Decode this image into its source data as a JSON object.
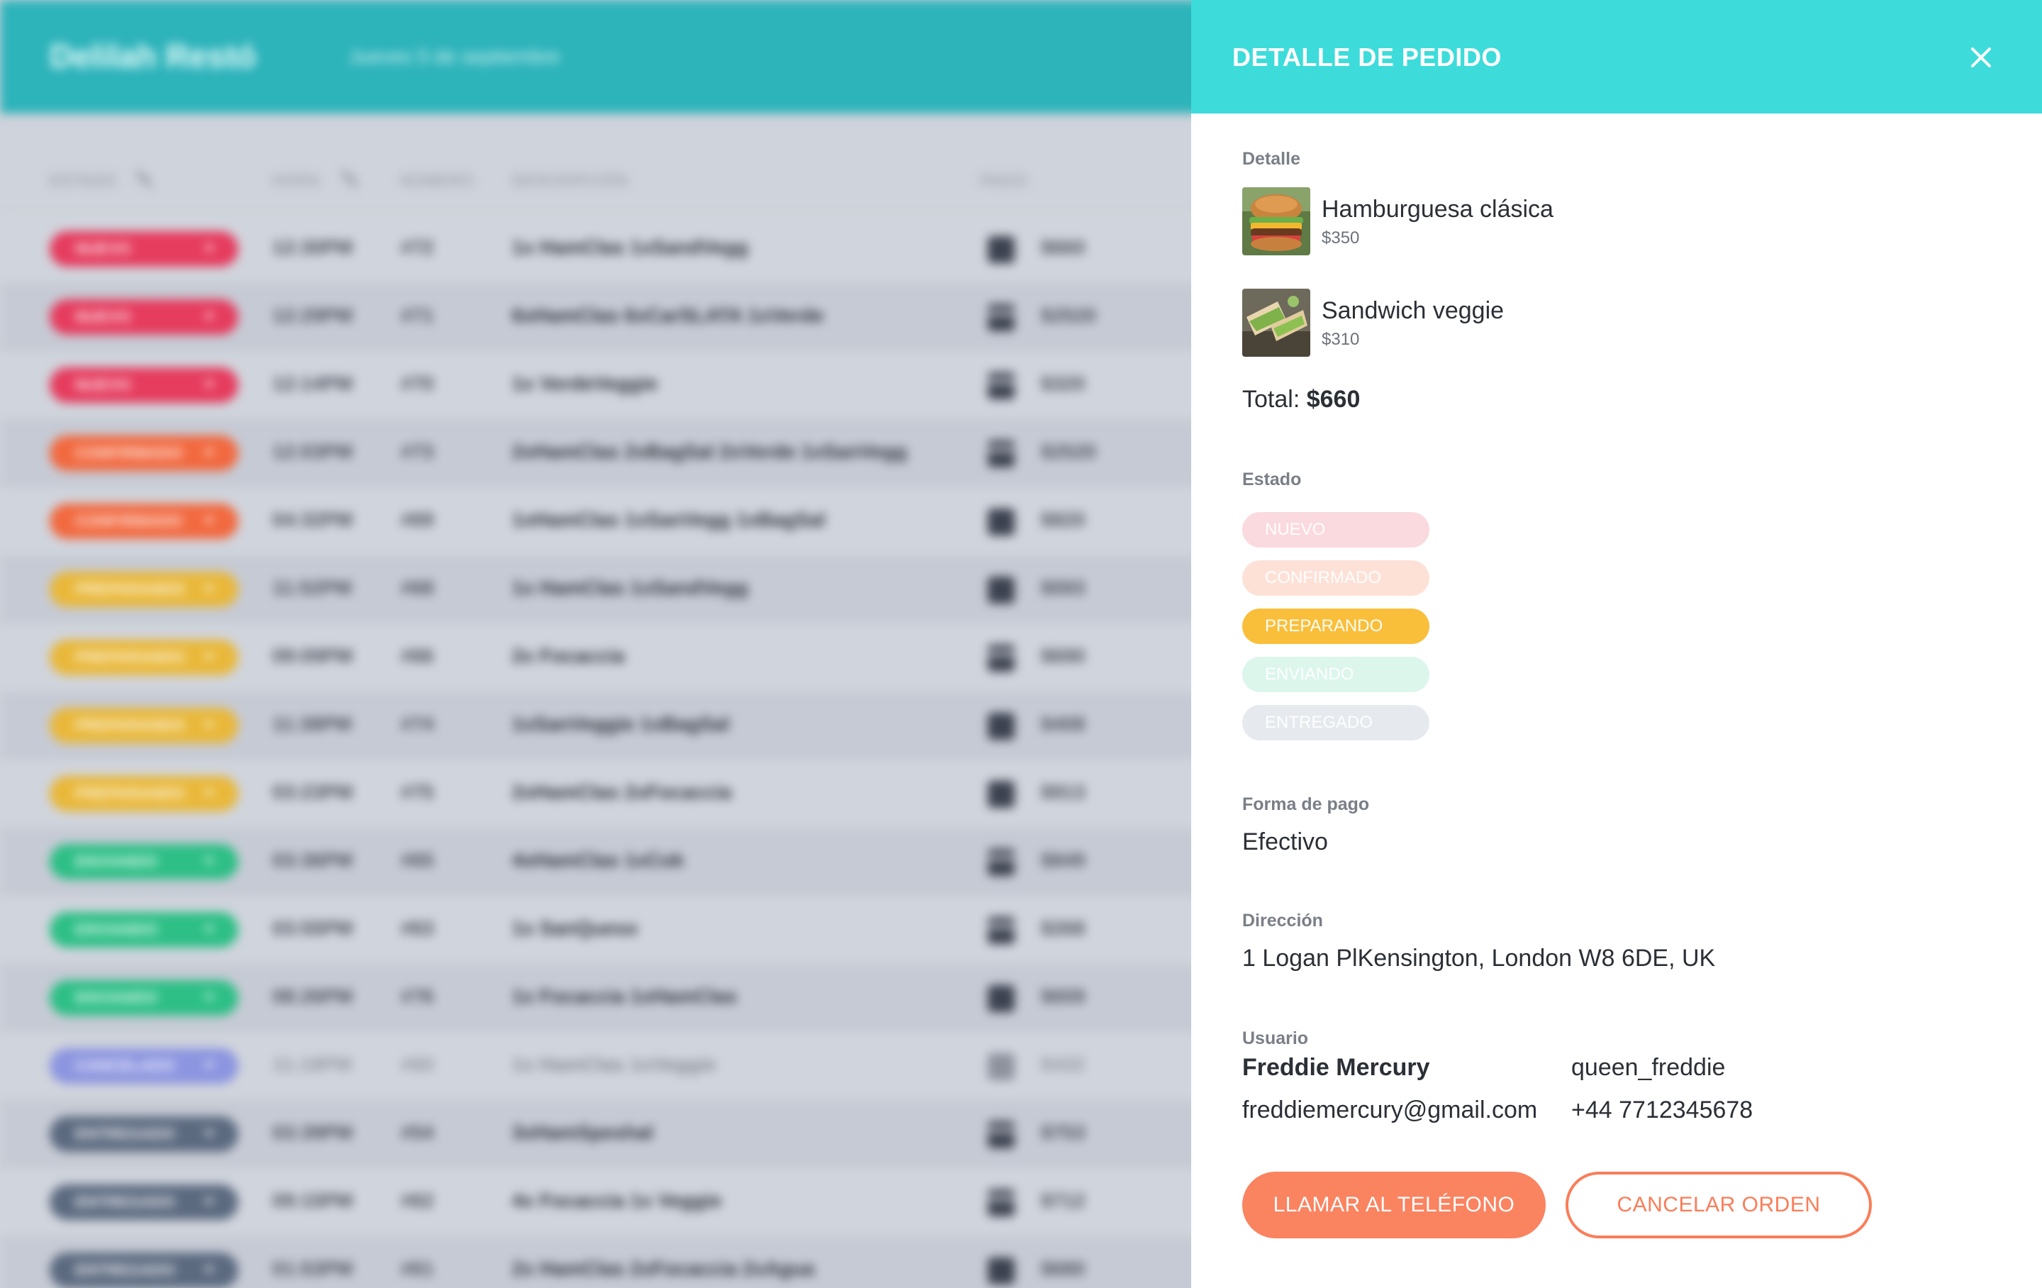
{
  "app": {
    "brand": "Delilah Restó",
    "date": "Jueves 5 de septiembre"
  },
  "table": {
    "headers": {
      "estado": "ESTADO",
      "hora": "HORA",
      "numero": "NÚMERO",
      "descripcion": "DESCRIPCIÓN",
      "pago": "PAGO"
    },
    "rows": [
      {
        "status": "NUEVO",
        "color": "#e63c5e",
        "time": "12:30PM",
        "number": "#72",
        "description": "1x HamClas 1xSandVegg",
        "pay": "cash",
        "amount": "$660"
      },
      {
        "status": "NUEVO",
        "color": "#e63c5e",
        "time": "12:29PM",
        "number": "#71",
        "description": "6xHamClas 6xCarSLATA 1xVerde",
        "pay": "card",
        "amount": "$2520"
      },
      {
        "status": "NUEVO",
        "color": "#e63c5e",
        "time": "12:14PM",
        "number": "#70",
        "description": "1x VerdeVeggie",
        "pay": "card",
        "amount": "$320"
      },
      {
        "status": "CONFIRMADO",
        "color": "#f2693f",
        "time": "12:03PM",
        "number": "#73",
        "description": "2xHamClas 2xBagSal 2xVerde 1xSanVegg",
        "pay": "card",
        "amount": "$2520"
      },
      {
        "status": "CONFIRMADO",
        "color": "#f2693f",
        "time": "04:32PM",
        "number": "#69",
        "description": "1xHamClas 1xSanVegg 1xBagSal",
        "pay": "cash",
        "amount": "$820"
      },
      {
        "status": "PREPARANDO",
        "color": "#e9b83a",
        "time": "11:52PM",
        "number": "#68",
        "description": "1x HamClas 1xSandVegg",
        "pay": "cash",
        "amount": "$593"
      },
      {
        "status": "PREPARANDO",
        "color": "#e9b83a",
        "time": "09:09PM",
        "number": "#66",
        "description": "2x Focaccia",
        "pay": "card",
        "amount": "$690"
      },
      {
        "status": "PREPARANDO",
        "color": "#e9b83a",
        "time": "11:38PM",
        "number": "#74",
        "description": "1xSanVeggie 1xBagSal",
        "pay": "cash",
        "amount": "$408"
      },
      {
        "status": "PREPARANDO",
        "color": "#e9b83a",
        "time": "03:23PM",
        "number": "#75",
        "description": "2xHamClas 2xFocaccia",
        "pay": "cash",
        "amount": "$913"
      },
      {
        "status": "ENVIANDO",
        "color": "#2dbf86",
        "time": "03:36PM",
        "number": "#65",
        "description": "4xHamClas 1xCok",
        "pay": "card",
        "amount": "$849"
      },
      {
        "status": "ENVIANDO",
        "color": "#2dbf86",
        "time": "03:55PM",
        "number": "#63",
        "description": "1x SanQueso",
        "pay": "card",
        "amount": "$268"
      },
      {
        "status": "ENVIANDO",
        "color": "#2dbf86",
        "time": "08:26PM",
        "number": "#76",
        "description": "1x Focaccia 1xHamClas",
        "pay": "cash",
        "amount": "$659"
      },
      {
        "status": "CANCELADO",
        "color": "#8c95e0",
        "time": "11:18PM",
        "number": "#60",
        "description": "1x HamClas 1xVeggie",
        "pay": "cash",
        "amount": "$432",
        "muted": true
      },
      {
        "status": "ENTREGADO",
        "color": "#5c6a80",
        "time": "03:39PM",
        "number": "#54",
        "description": "3xHamSpeshal",
        "pay": "card",
        "amount": "$753"
      },
      {
        "status": "ENTREGADO",
        "color": "#5c6a80",
        "time": "09:15PM",
        "number": "#62",
        "description": "4x Focaccia 1x Veggie",
        "pay": "card",
        "amount": "$712"
      },
      {
        "status": "ENTREGADO",
        "color": "#5c6a80",
        "time": "01:53PM",
        "number": "#61",
        "description": "2x HamClas 2xFocaccia 2xAgua",
        "pay": "cash",
        "amount": "$680"
      }
    ]
  },
  "drawer": {
    "title": "DETALLE DE PEDIDO",
    "close_icon": "close-icon",
    "detail_label": "Detalle",
    "items": [
      {
        "name": "Hamburguesa clásica",
        "price": "$350",
        "thumb": "burger"
      },
      {
        "name": "Sandwich veggie",
        "price": "$310",
        "thumb": "sandwich"
      }
    ],
    "total_label": "Total:",
    "total_value": "$660",
    "status_label": "Estado",
    "statuses": [
      {
        "label": "NUEVO",
        "color": "#fadadf",
        "active": false
      },
      {
        "label": "CONFIRMADO",
        "color": "#fde1d7",
        "active": false
      },
      {
        "label": "PREPARANDO",
        "color": "#f9bf3b",
        "active": true
      },
      {
        "label": "ENVIANDO",
        "color": "#dcf6ec",
        "active": false
      },
      {
        "label": "ENTREGADO",
        "color": "#e6e9ee",
        "active": false
      }
    ],
    "payment_label": "Forma de pago",
    "payment_value": "Efectivo",
    "address_label": "Dirección",
    "address_value": "1 Logan PlKensington, London W8 6DE, UK",
    "user_label": "Usuario",
    "user_name": "Freddie Mercury",
    "user_handle": "queen_freddie",
    "user_email": "freddiemercury@gmail.com",
    "user_phone": "+44 7712345678",
    "call_button": "LLAMAR AL TELÉFONO",
    "cancel_button": "CANCELAR ORDEN",
    "colors": {
      "header": "#3ddcda",
      "primary_button": "#fa8360",
      "secondary_border": "#fa7d58"
    }
  }
}
